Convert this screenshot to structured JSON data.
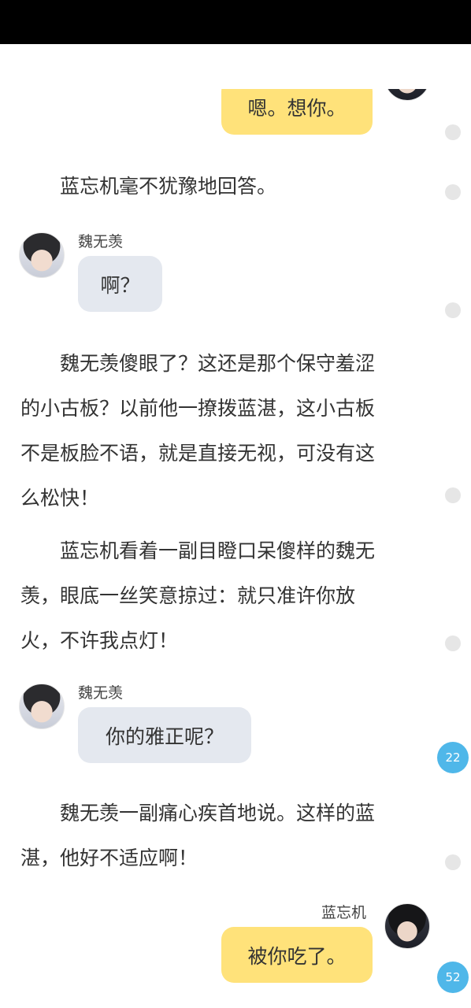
{
  "messages": [
    {
      "speaker": "",
      "text": "嗯。想你。"
    },
    {
      "speaker": "魏无羡",
      "text": "啊？"
    },
    {
      "speaker": "魏无羡",
      "text": "你的雅正呢？"
    },
    {
      "speaker": "蓝忘机",
      "text": "被你吃了。"
    }
  ],
  "paragraphs": [
    {
      "lines": [
        "　　蓝忘机毫不犹豫地回答。"
      ]
    },
    {
      "lines": [
        "　　魏无羡傻眼了？这还是那个保守羞涩",
        "的小古板？以前他一撩拨蓝湛，这小古板",
        "不是板脸不语，就是直接无视，可没有这",
        "么松快！"
      ]
    },
    {
      "lines": [
        "　　蓝忘机看着一副目瞪口呆傻样的魏无",
        "羡，眼底一丝笑意掠过：就只准许你放",
        "火，不许我点灯！"
      ]
    },
    {
      "lines": [
        "　　魏无羡一副痛心疾首地说。这样的蓝",
        "湛，他好不适应啊！"
      ]
    }
  ],
  "comment_counts": [
    "22",
    "52"
  ],
  "icons": {
    "comment_dot": "comment-dot-icon",
    "avatar": "avatar-icon"
  },
  "colors": {
    "own_bubble": "#ffe27a",
    "other_bubble": "#e4e8ef",
    "comment_badge": "#4fb7e9",
    "status_bar": "#000000"
  }
}
